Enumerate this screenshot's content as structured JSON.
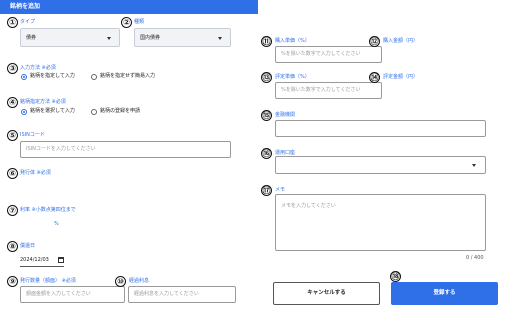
{
  "header": {
    "title": "銘柄を追加"
  },
  "form": {
    "type": {
      "num": "①",
      "label": "タイプ",
      "value": "債券"
    },
    "category": {
      "num": "②",
      "label": "種類",
      "value": "国内債券"
    },
    "input_method": {
      "num": "③",
      "label": "入力方法",
      "required": "※必須",
      "options": [
        "銘柄を指定して入力",
        "銘柄を指定せず簡易入力"
      ],
      "selected": 0
    },
    "designation_method": {
      "num": "④",
      "label": "銘柄指定方法",
      "required": "※必須",
      "options": [
        "銘柄を選択して入力",
        "銘柄の登録を申請"
      ],
      "selected": 0
    },
    "isin": {
      "num": "⑤",
      "label": "ISINコード",
      "placeholder": "ISINコードを入力してください"
    },
    "issuer": {
      "num": "⑥",
      "label": "発行体",
      "required": "※必須"
    },
    "rate": {
      "num": "⑦",
      "label": "利率",
      "required": "※小数点第四位まで",
      "unit": "%"
    },
    "maturity": {
      "num": "⑧",
      "label": "償還日",
      "value": "2024/12/03"
    },
    "quantity": {
      "num": "⑨",
      "label": "発行数量（額面）",
      "required": "※必須",
      "placeholder": "額面金額を入力してください"
    },
    "accrued_interest": {
      "num": "⑩",
      "label": "経過利息",
      "placeholder": "経過利息を入力してください"
    },
    "purchase_price": {
      "num": "⑪",
      "label": "購入単価（%）",
      "placeholder": "%を除いた数字で入力してください"
    },
    "purchase_amount": {
      "num": "⑫",
      "label": "購入金額（円）"
    },
    "valuation_price": {
      "num": "⑬",
      "label": "評定単価（%）",
      "placeholder": "%を除いた数字で入力してください"
    },
    "valuation_amount": {
      "num": "⑭",
      "label": "評定金額（円）"
    },
    "institution": {
      "num": "⑮",
      "label": "金融機関"
    },
    "account": {
      "num": "⑯",
      "label": "運用口座"
    },
    "memo": {
      "num": "⑰",
      "label": "メモ",
      "placeholder": "メモを入力してください",
      "counter": "0 / 400"
    }
  },
  "actions": {
    "num": "⑱",
    "cancel": "キャンセルする",
    "submit": "登録する"
  },
  "colors": {
    "accent": "#2f6fe8"
  }
}
